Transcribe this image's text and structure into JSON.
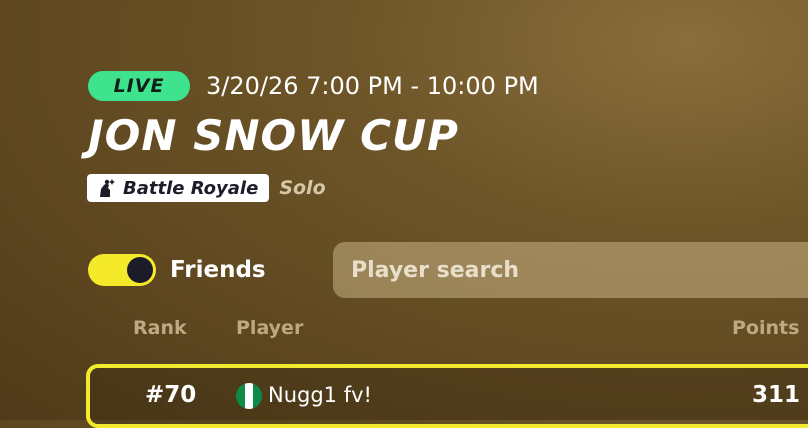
{
  "event": {
    "status_badge": "LIVE",
    "datetime": "3/20/26 7:00 PM - 10:00 PM",
    "title": "JON SNOW CUP",
    "mode": "Battle Royale",
    "mode_icon": "battle-royale-icon",
    "format": "Solo"
  },
  "filters": {
    "friends_label": "Friends",
    "friends_toggle_on": true,
    "search_placeholder": "Player search"
  },
  "leaderboard": {
    "columns": {
      "rank": "Rank",
      "player": "Player",
      "points": "Points"
    },
    "rows": [
      {
        "rank": "#70",
        "flag": "nigeria-flag",
        "name": "Nugg1 fv!",
        "points": "311"
      }
    ]
  },
  "colors": {
    "live": "#3fe38e",
    "toggle": "#f5ea2a",
    "highlight_border": "#f2ea2e",
    "flag_green": "#108a4a"
  }
}
